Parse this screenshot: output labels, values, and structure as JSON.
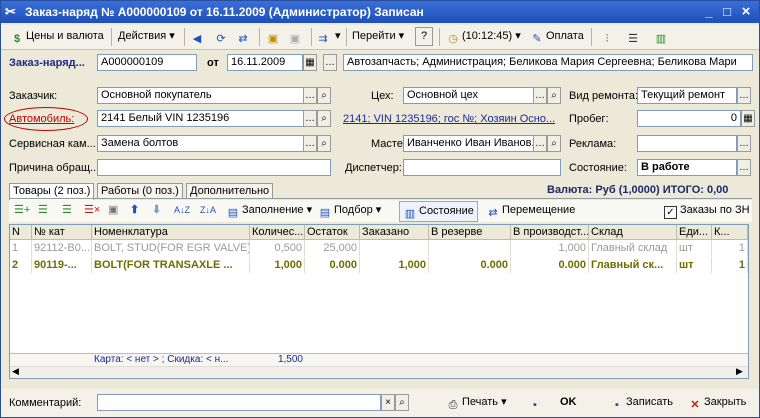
{
  "window": {
    "title": "Заказ-наряд № А000000109 от 16.11.2009 (Администратор) Записан",
    "minimize": "_",
    "maximize": "□",
    "close": "×"
  },
  "toolbar": {
    "prices_currency": "Цены и валюта",
    "actions": "Действия",
    "goto": "Перейти",
    "help": "?",
    "time": "(10:12:45)",
    "payment": "Оплата"
  },
  "header": {
    "doc_label": "Заказ-наряд...",
    "doc_number": "А000000109",
    "date_label": "от",
    "date_value": "16.11.2009",
    "org_value": "Автозапчасть; Администрация; Беликова Мария Сергеевна; Беликова Мари"
  },
  "form": {
    "customer_label": "Заказчик:",
    "customer_value": "Основной покупатель",
    "workshop_label": "Цех:",
    "workshop_value": "Основной цех",
    "repair_type_label": "Вид ремонта:",
    "repair_type_value": "Текущий ремонт",
    "car_label": "Автомобиль:",
    "car_value": "2141 Белый VIN 1235196",
    "car_link": "2141; VIN 1235196; гос №; Хозяин Осно...",
    "mileage_label": "Пробег:",
    "mileage_value": "0",
    "service_label": "Сервисная кам...",
    "service_value": "Замена болтов",
    "master_label": "Мастер:",
    "master_value": "Иванченко Иван Иванов...",
    "ad_label": "Реклама:",
    "ad_value": "",
    "reason_label": "Причина обращ...",
    "reason_value": "",
    "dispatcher_label": "Диспетчер:",
    "dispatcher_value": "",
    "state_label": "Состояние:",
    "state_value": "В работе"
  },
  "tabs": [
    {
      "label": "Товары (2 поз.)"
    },
    {
      "label": "Работы (0 поз.)"
    },
    {
      "label": "Дополнительно"
    }
  ],
  "currency_total": "Валюта: Руб (1,0000) ИТОГО: 0,00",
  "grid_toolbar": {
    "fill": "Заполнение",
    "select": "Подбор",
    "state": "Состояние",
    "move": "Перемещение",
    "orders_check": "Заказы по ЗН"
  },
  "grid": {
    "columns": [
      "N",
      "№ кат",
      "Номенклатура",
      "Количес...",
      "Остаток",
      "Заказано",
      "В резерве",
      "В производст...",
      "Склад",
      "Еди...",
      "К..."
    ],
    "rows": [
      [
        "1",
        "92112-B0...",
        "BOLT, STUD(FOR EGR VALVE)",
        "0,500",
        "25,000",
        "",
        "",
        "1,000",
        "Главный склад",
        "шт",
        "1"
      ],
      [
        "2",
        "90119-...",
        "BOLT(FOR TRANSAXLE ...",
        "1,000",
        "0.000",
        "1,000",
        "0.000",
        "0.000",
        "Главный ск...",
        "шт",
        "1"
      ]
    ],
    "footer_card": "Карта: < нет > ; Скидка: < н...",
    "footer_qty": "1,500"
  },
  "bottom": {
    "comment_label": "Комментарий:",
    "comment_value": "",
    "print": "Печать",
    "ok": "OK",
    "save": "Записать",
    "close": "Закрыть"
  },
  "colors": {
    "title_bg": "#2454c4",
    "car_label_red": "#c00000",
    "row_highlight": "#6e6e00"
  }
}
